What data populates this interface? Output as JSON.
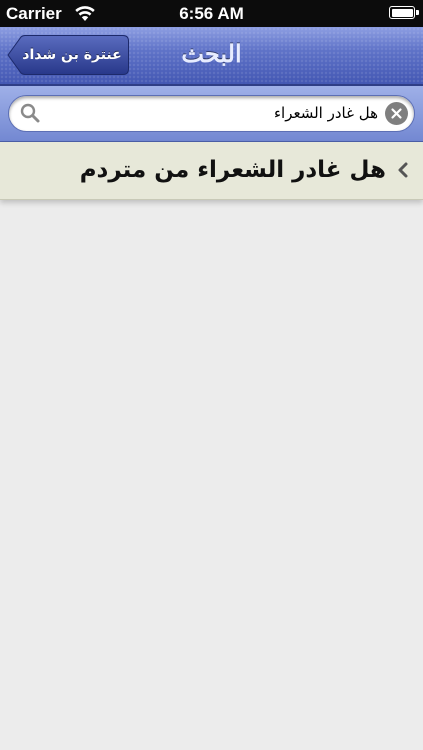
{
  "status_bar": {
    "carrier": "Carrier",
    "time": "6:56 AM",
    "wifi_icon": "wifi-icon",
    "battery_icon": "battery-icon",
    "battery_level": 1.0
  },
  "nav_bar": {
    "title": "البحث",
    "back_label": "عنترة بن شداد",
    "accent_color": "#5f73c8"
  },
  "search": {
    "value": "هل غادر الشعراء",
    "search_icon": "search-icon",
    "clear_icon": "clear-icon"
  },
  "results": [
    {
      "text": "هل  غادر  الشعراء  من  متردم",
      "icon": "chevron-left-icon"
    }
  ]
}
